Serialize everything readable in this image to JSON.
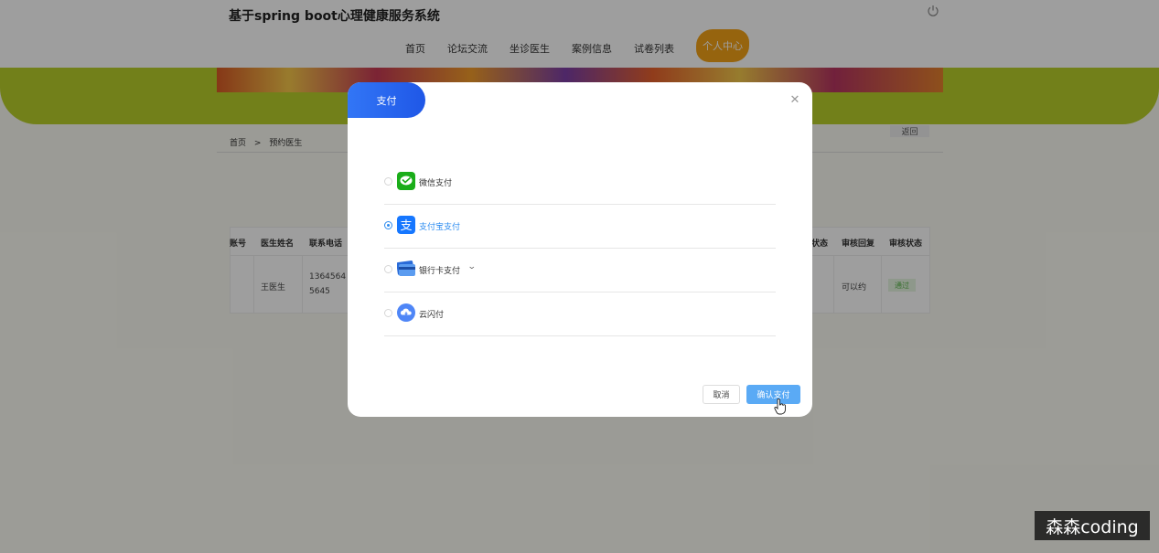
{
  "header": {
    "title": "基于spring boot心理健康服务系统",
    "power_icon": "power-icon",
    "nav": [
      {
        "label": "首页"
      },
      {
        "label": "论坛交流"
      },
      {
        "label": "坐诊医生"
      },
      {
        "label": "案例信息"
      },
      {
        "label": "试卷列表"
      },
      {
        "label": "个人中心",
        "active": true
      }
    ]
  },
  "breadcrumb": {
    "home": "首页",
    "separator": ">",
    "current": "预约医生"
  },
  "back_button": "返回",
  "table": {
    "columns": [
      "账号",
      "医生姓名",
      "联系电话",
      "状态",
      "审核回复",
      "审核状态"
    ],
    "row": {
      "doctor_name": "王医生",
      "phone_line1": "1364564",
      "phone_line2": "5645",
      "review_reply": "可以约",
      "review_status": "通过"
    }
  },
  "modal": {
    "title": "支付",
    "close_icon": "close-icon",
    "options": [
      {
        "label": "微信支付",
        "icon": "wechat-pay-icon",
        "selected": false
      },
      {
        "label": "支付宝支付",
        "icon": "alipay-icon",
        "selected": true
      },
      {
        "label": "银行卡支付",
        "icon": "bank-card-icon",
        "selected": false,
        "has_dropdown": true
      },
      {
        "label": "云闪付",
        "icon": "cloud-pay-icon",
        "selected": false
      }
    ],
    "cancel": "取消",
    "confirm": "确认支付"
  },
  "watermark": "森森coding",
  "colors": {
    "accent": "#2d8cf0",
    "confirm": "#5aaaf5",
    "nav_active": "#f2a217",
    "banner": "#b8cf2a"
  }
}
